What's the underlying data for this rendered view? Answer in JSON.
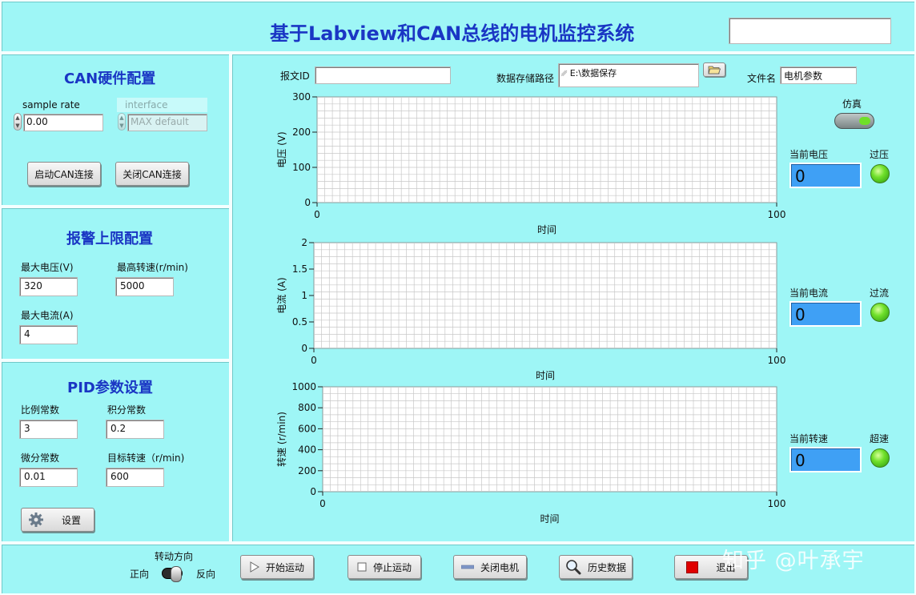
{
  "app_title": "基于Labview和CAN总线的电机监控系统",
  "title_blank_field": "",
  "can_config": {
    "title": "CAN硬件配置",
    "sample_rate_label": "sample rate",
    "sample_rate_value": "0.00",
    "interface_label": "interface",
    "interface_value": "MAX default",
    "start_button": "启动CAN连接",
    "close_button": "关闭CAN连接"
  },
  "alarm_config": {
    "title": "报警上限配置",
    "max_voltage_label": "最大电压(V)",
    "max_voltage_value": "320",
    "max_speed_label": "最高转速(r/min)",
    "max_speed_value": "5000",
    "max_current_label": "最大电流(A)",
    "max_current_value": "4"
  },
  "pid_config": {
    "title": "PID参数设置",
    "kp_label": "比例常数",
    "kp_value": "3",
    "ki_label": "积分常数",
    "ki_value": "0.2",
    "kd_label": "微分常数",
    "kd_value": "0.01",
    "target_label": "目标转速（r/min)",
    "target_value": "600",
    "set_button": "设置"
  },
  "top_fields": {
    "msg_id_label": "报文ID",
    "msg_id_value": "",
    "storage_path_label": "数据存储路径",
    "storage_path_value": "E:\\数据保存",
    "filename_label": "文件名",
    "filename_value": "电机参数"
  },
  "simulation": {
    "label": "仿真",
    "state": "on"
  },
  "monitors": [
    {
      "current_label": "当前电压",
      "value": "0",
      "alarm_label": "过压",
      "led_color": "#5cd62a"
    },
    {
      "current_label": "当前电流",
      "value": "0",
      "alarm_label": "过流",
      "led_color": "#5cd62a"
    },
    {
      "current_label": "当前转速",
      "value": "0",
      "alarm_label": "超速",
      "led_color": "#5cd62a"
    }
  ],
  "chart_data": [
    {
      "type": "line",
      "ylabel": "电压 (V)",
      "xlabel": "时间",
      "xlim": [
        0,
        100
      ],
      "ylim": [
        0,
        300
      ],
      "x_ticks": [
        "0",
        "100"
      ],
      "y_ticks": [
        "0",
        "100",
        "200",
        "300"
      ],
      "grid": true,
      "series": []
    },
    {
      "type": "line",
      "ylabel": "电流 (A)",
      "xlabel": "时间",
      "xlim": [
        0,
        100
      ],
      "ylim": [
        0,
        2
      ],
      "x_ticks": [
        "0",
        "100"
      ],
      "y_ticks": [
        "0",
        "0.5",
        "1",
        "1.5",
        "2"
      ],
      "grid": true,
      "series": []
    },
    {
      "type": "line",
      "ylabel": "转速 (r/min)",
      "xlabel": "时间",
      "xlim": [
        0,
        100
      ],
      "ylim": [
        0,
        1000
      ],
      "x_ticks": [
        "0",
        "100"
      ],
      "y_ticks": [
        "0",
        "200",
        "400",
        "600",
        "800",
        "1000"
      ],
      "grid": true,
      "series": []
    }
  ],
  "bottom_bar": {
    "direction_label": "转动方向",
    "forward_label": "正向",
    "reverse_label": "反向",
    "start_button": "开始运动",
    "stop_button": "停止运动",
    "motor_off_button": "关闭电机",
    "history_button": "历史数据",
    "exit_button": "退出"
  },
  "watermark": "知乎 @叶承宇",
  "colors": {
    "panel_bg": "#9ef6f6",
    "title_blue": "#1a36c4",
    "display_blue": "#3fa0f5",
    "led_green": "#5cd62a",
    "stop_red": "#e00000"
  }
}
